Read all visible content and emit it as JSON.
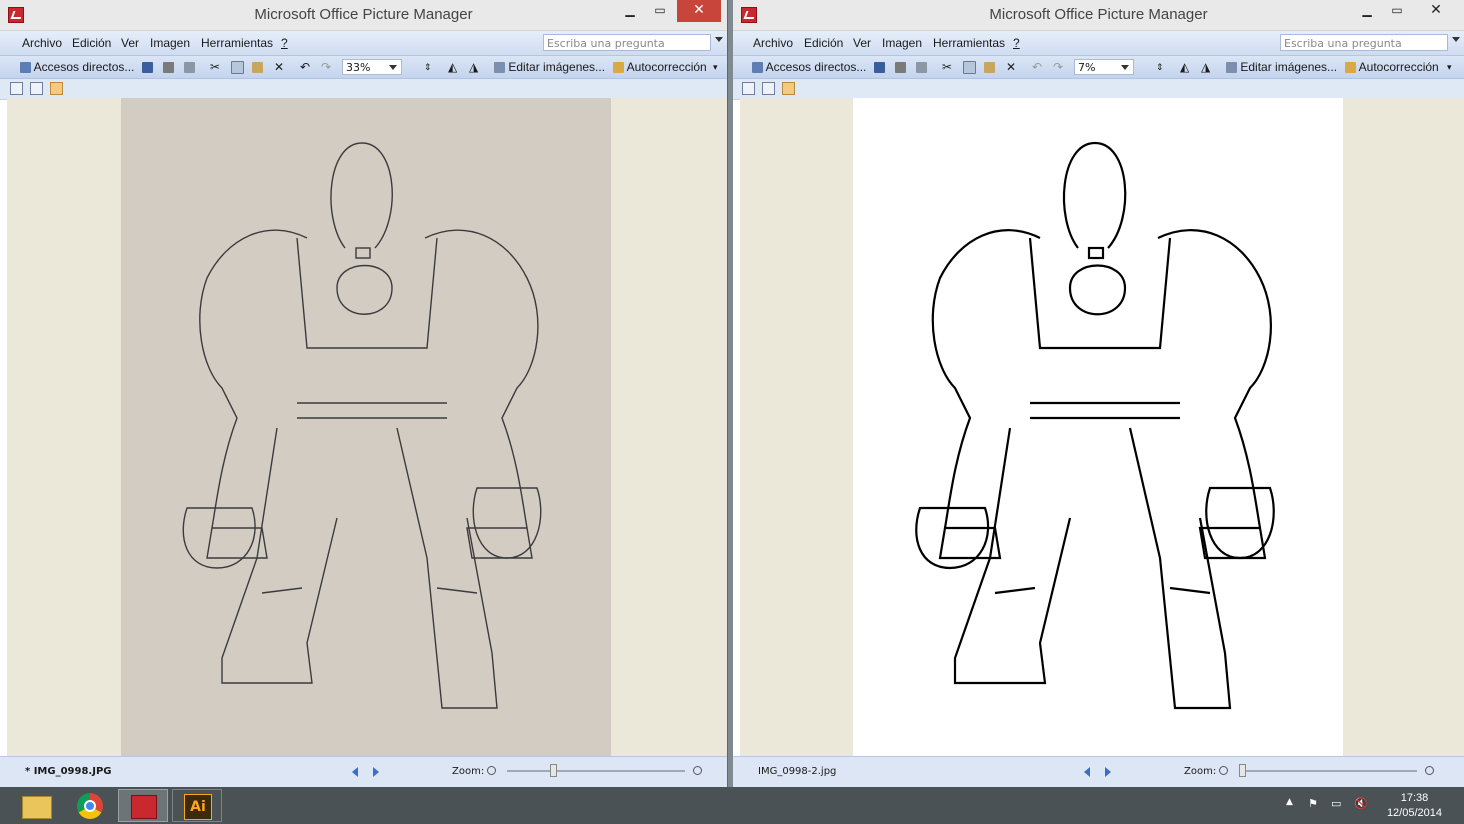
{
  "windows": [
    {
      "title": "Microsoft Office Picture Manager",
      "menu": [
        "Archivo",
        "Edición",
        "Ver",
        "Imagen",
        "Herramientas",
        "?"
      ],
      "ask_placeholder": "Escriba una pregunta",
      "toolbar": {
        "shortcuts": "Accesos directos...",
        "zoom": "33%",
        "edit": "Editar imágenes...",
        "autocorrect": "Autocorrección"
      },
      "status": {
        "filename": "* IMG_0998.JPG",
        "zoom_label": "Zoom:",
        "zoom_slider_value": 0.25
      },
      "image": "pencil sketch on paper"
    },
    {
      "title": "Microsoft Office Picture Manager",
      "menu": [
        "Archivo",
        "Edición",
        "Ver",
        "Imagen",
        "Herramientas",
        "?"
      ],
      "ask_placeholder": "Escriba una pregunta",
      "toolbar": {
        "shortcuts": "Accesos directos...",
        "zoom": "7%",
        "edit": "Editar imágenes...",
        "autocorrect": "Autocorrección"
      },
      "status": {
        "filename": "IMG_0998-2.jpg",
        "zoom_label": "Zoom:",
        "zoom_slider_value": 0.0
      },
      "image": "inked line art"
    }
  ],
  "taskbar": {
    "items": [
      "file-explorer",
      "chrome",
      "picture-manager",
      "illustrator"
    ],
    "illustrator_label": "Ai",
    "time": "17:38",
    "date": "12/05/2014"
  },
  "colors": {
    "titlebar": "#e9e9e9",
    "close": "#c7453a",
    "menubar": "#dbe6f6",
    "canvas": "#ebe8da",
    "taskbar": "#4a5256",
    "paper": "#d3ccc2"
  }
}
